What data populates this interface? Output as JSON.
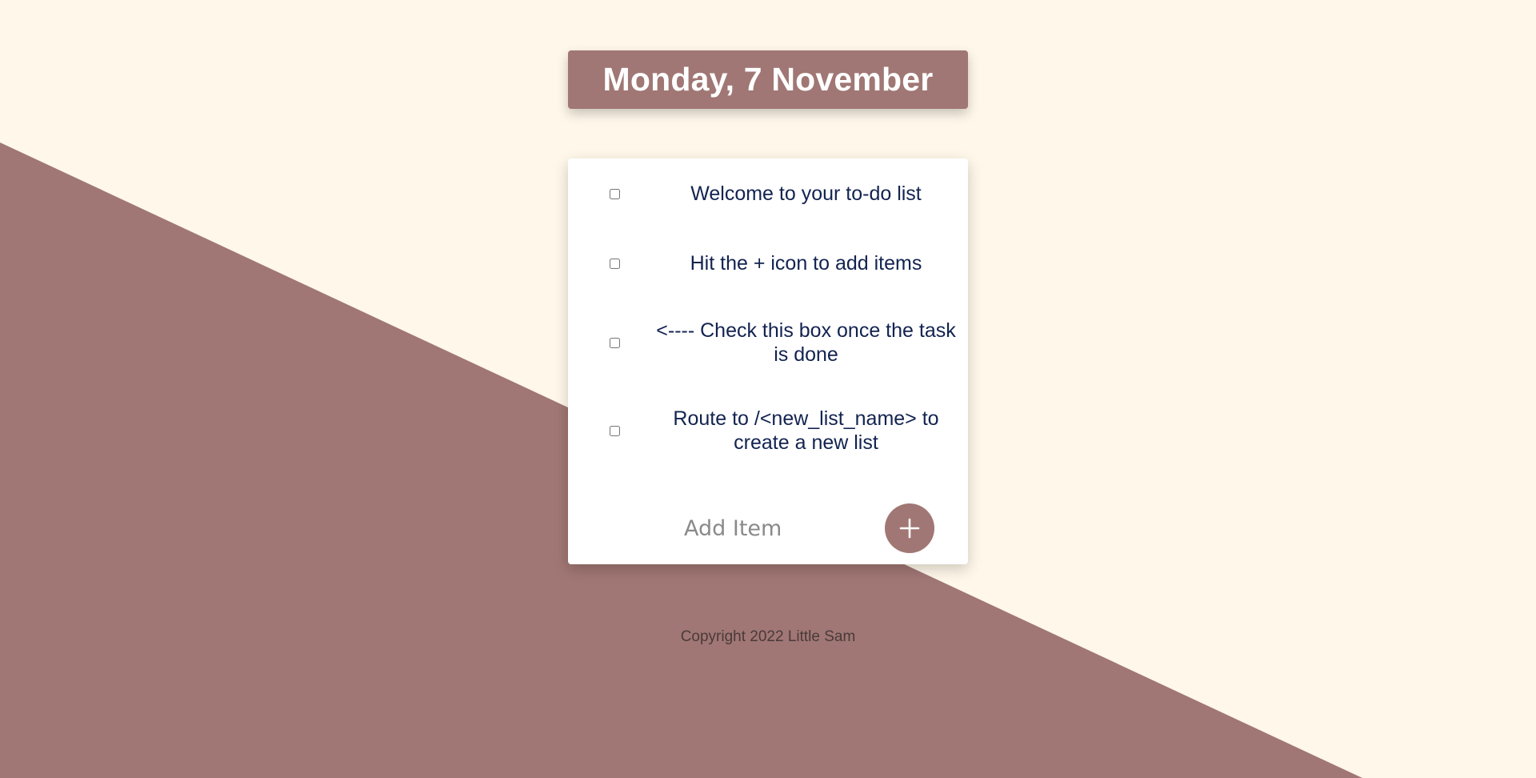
{
  "colors": {
    "background": "#fff7e9",
    "accent": "#a07774",
    "card": "#ffffff",
    "item_text": "#122350"
  },
  "header": {
    "title": "Monday, 7 November"
  },
  "items": [
    {
      "text": "Welcome to your to-do list",
      "checked": false
    },
    {
      "text": "Hit the + icon to add items",
      "checked": false
    },
    {
      "text": "<---- Check this box once the task is done",
      "checked": false
    },
    {
      "text": "Route to /<new_list_name> to create a new list",
      "checked": false
    }
  ],
  "add_form": {
    "placeholder": "Add Item",
    "button_icon": "plus-icon"
  },
  "footer": {
    "copyright": "Copyright 2022 Little Sam"
  }
}
